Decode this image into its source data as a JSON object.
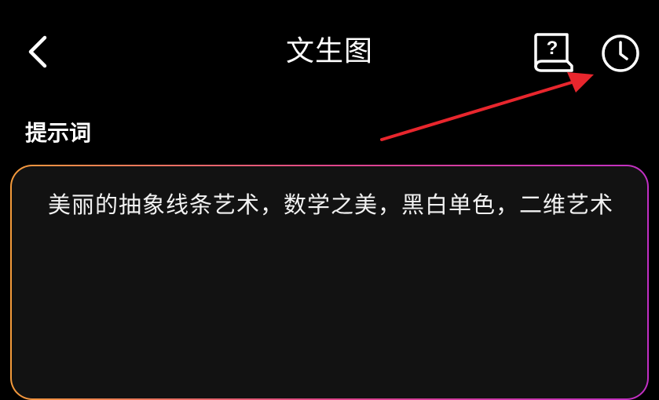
{
  "header": {
    "title": "文生图",
    "back_icon": "chevron-left-icon",
    "help_icon": "help-book-icon",
    "history_icon": "clock-icon"
  },
  "prompt": {
    "label": "提示词",
    "text": "美丽的抽象线条艺术，数学之美，黑白单色，二维艺术"
  },
  "colors": {
    "background": "#000000",
    "input_background": "#121212",
    "border_gradient": [
      "#f39a3b",
      "#e0468a",
      "#c130c4"
    ],
    "annotation_arrow": "#e8262d"
  }
}
